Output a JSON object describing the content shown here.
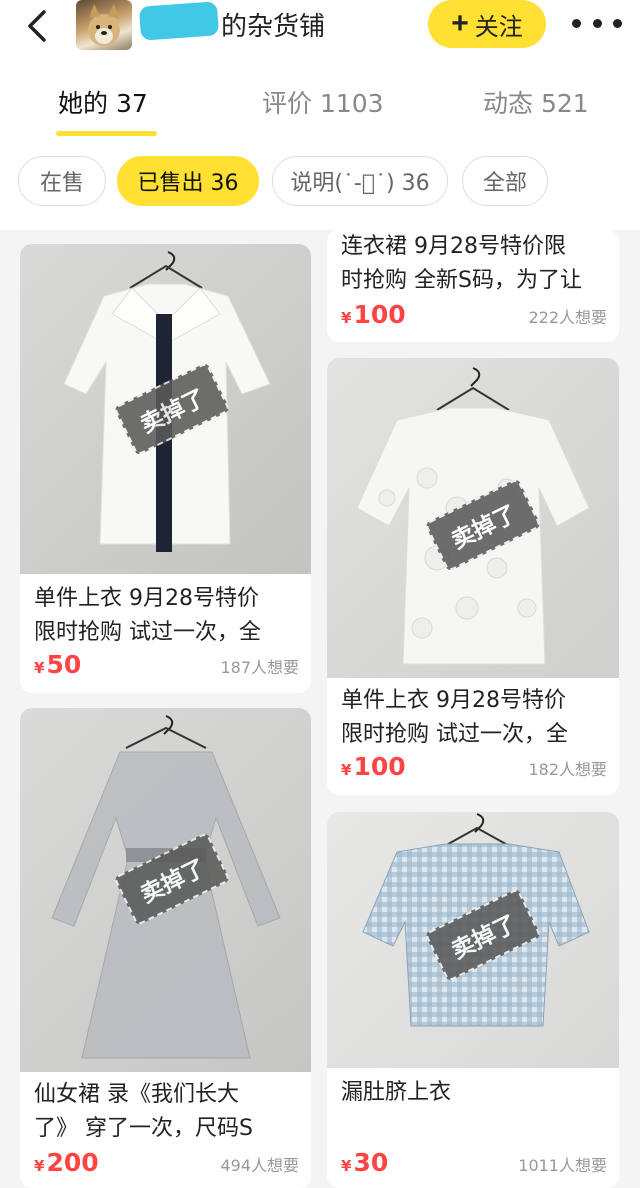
{
  "header": {
    "shop_name": "的杂货铺",
    "follow_label": "关注"
  },
  "tabs": [
    {
      "label": "她的 37",
      "active": true
    },
    {
      "label": "评价 1103",
      "active": false
    },
    {
      "label": "动态 521",
      "active": false
    }
  ],
  "filters": [
    {
      "label": "在售",
      "active": false
    },
    {
      "label": "已售出 36",
      "active": true
    },
    {
      "label": "说明(˙-ᷦ˙) 36",
      "active": false
    },
    {
      "label": "全部",
      "active": false
    }
  ],
  "stamp_text": "卖掉了",
  "colors": {
    "accent": "#ffe033",
    "price": "#ff4444"
  },
  "products": [
    {
      "title_line1": "连衣裙  9月28号特价限",
      "title_line2": "时抢购  全新S码，为了让",
      "price": "100",
      "wants": "222人想要"
    },
    {
      "title_line1": "单件上衣  9月28号特价",
      "title_line2": "限时抢购  试过一次，全",
      "price": "50",
      "wants": "187人想要"
    },
    {
      "title_line1": "单件上衣  9月28号特价",
      "title_line2": "限时抢购  试过一次，全",
      "price": "100",
      "wants": "182人想要"
    },
    {
      "title_line1": "仙女裙      录《我们长大",
      "title_line2": "了》 穿了一次，尺码S",
      "price": "200",
      "wants": "494人想要"
    },
    {
      "title_line1": "漏肚脐上衣",
      "title_line2": "",
      "price": "30",
      "wants": "1011人想要"
    }
  ],
  "currency": "¥"
}
